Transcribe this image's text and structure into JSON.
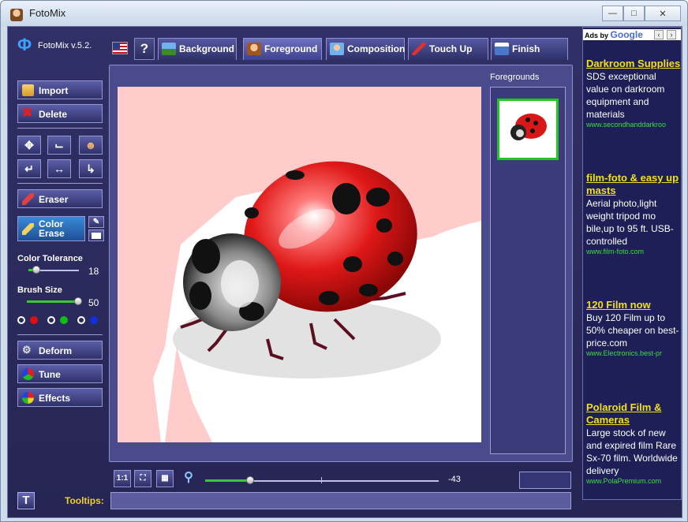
{
  "window": {
    "title": "FotoMix",
    "controls": [
      "minimize",
      "maximize",
      "close"
    ]
  },
  "app": {
    "version": "FotoMix v.5.2."
  },
  "tabs": [
    {
      "label": "Background",
      "icon": "landscape-icon",
      "active": false
    },
    {
      "label": "Foreground",
      "icon": "portrait-icon",
      "active": true
    },
    {
      "label": "Composition",
      "icon": "composition-icon",
      "active": false
    },
    {
      "label": "Touch Up",
      "icon": "brush-icon",
      "active": false
    },
    {
      "label": "Finish",
      "icon": "save-icon",
      "active": false
    }
  ],
  "sidebar": {
    "import": "Import",
    "delete": "Delete",
    "eraser": "Eraser",
    "color_erase_line1": "Color",
    "color_erase_line2": "Erase",
    "color_tolerance": {
      "label": "Color Tolerance",
      "value": "18"
    },
    "brush_size": {
      "label": "Brush Size",
      "value": "50"
    },
    "deform": "Deform",
    "tune": "Tune",
    "effects": "Effects"
  },
  "panel": {
    "foregrounds_label": "Foregrounds"
  },
  "bottom": {
    "zoom_value": "-43",
    "tooltips_label": "Tooltips:",
    "one_to_one": "1:1"
  },
  "ads": {
    "header": "Ads by",
    "google": "Google",
    "items": [
      {
        "title": "Darkroom Supplies",
        "body": "SDS exceptional value on darkroom equipment and materials",
        "url": "www.secondhanddarkroo"
      },
      {
        "title": "film-foto & easy up masts",
        "body": "Aerial photo,light weight tripod mo bile,up to 95 ft. USB-controlled",
        "url": "www.film-foto.com"
      },
      {
        "title": "120 Film now",
        "body": "Buy 120 Film up to 50% cheaper on best-price.com",
        "url": "www.Electronics.best-pr"
      },
      {
        "title": "Polaroid Film & Cameras",
        "body": "Large stock of new and expired film Rare Sx-70 film. Worldwide delivery",
        "url": "www.PolaPremium.com"
      }
    ]
  },
  "colors": {
    "accent": "#3cc63c",
    "ad_title": "#f0e020",
    "background": "#262554"
  }
}
